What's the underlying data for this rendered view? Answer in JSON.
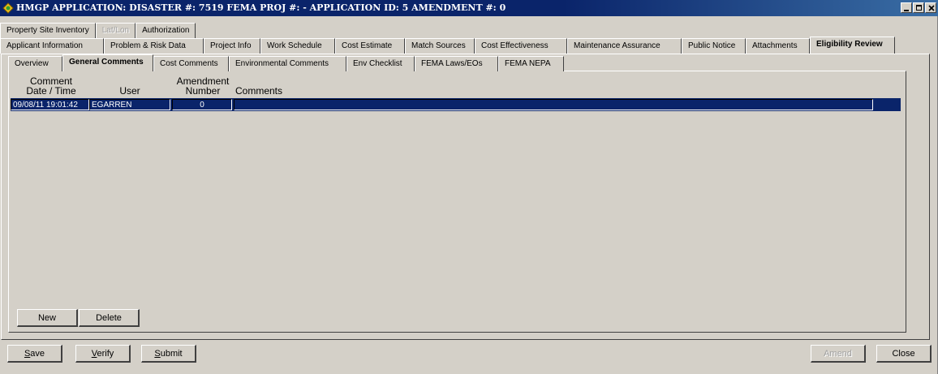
{
  "window": {
    "title": "HMGP APPLICATION:  DISASTER #: 7519   FEMA PROJ #:  -    APPLICATION ID: 5   AMENDMENT #: 0"
  },
  "tabs_row1": [
    {
      "label": "Property Site Inventory",
      "disabled": false
    },
    {
      "label": "Lat/Lon",
      "disabled": true
    },
    {
      "label": "Authorization",
      "disabled": false
    }
  ],
  "tabs_row2": [
    {
      "label": "Applicant Information"
    },
    {
      "label": "Problem & Risk Data"
    },
    {
      "label": "Project Info"
    },
    {
      "label": "Work Schedule"
    },
    {
      "label": "Cost Estimate"
    },
    {
      "label": "Match Sources"
    },
    {
      "label": "Cost Effectiveness"
    },
    {
      "label": "Maintenance Assurance"
    },
    {
      "label": "Public Notice"
    },
    {
      "label": "Attachments"
    },
    {
      "label": "Eligibility Review"
    }
  ],
  "tabs_row3": [
    {
      "label": "Overview"
    },
    {
      "label": "General Comments"
    },
    {
      "label": "Cost Comments"
    },
    {
      "label": "Environmental Comments"
    },
    {
      "label": "Env Checklist"
    },
    {
      "label": "FEMA Laws/EOs"
    },
    {
      "label": "FEMA NEPA"
    }
  ],
  "grid": {
    "headers": {
      "datetime_line1": "Comment",
      "datetime_line2": "Date / Time",
      "user": "User",
      "amend_line1": "Amendment",
      "amend_line2": "Number",
      "comments": "Comments"
    },
    "rows": [
      {
        "datetime": "09/08/11 19:01:42",
        "user": "EGARREN",
        "amendment": "0",
        "comments": ""
      }
    ]
  },
  "inner_buttons": {
    "new": "New",
    "delete": "Delete"
  },
  "bottom_buttons": {
    "save_pre": "",
    "save_u": "S",
    "save_post": "ave",
    "verify_pre": "",
    "verify_u": "V",
    "verify_post": "erify",
    "submit_pre": "",
    "submit_u": "S",
    "submit_post": "ubmit",
    "amend": "Amend",
    "close": "Close"
  },
  "colors": {
    "title_bar": "#0a246a",
    "selected_row": "#0a246a",
    "face": "#d4d0c8"
  }
}
